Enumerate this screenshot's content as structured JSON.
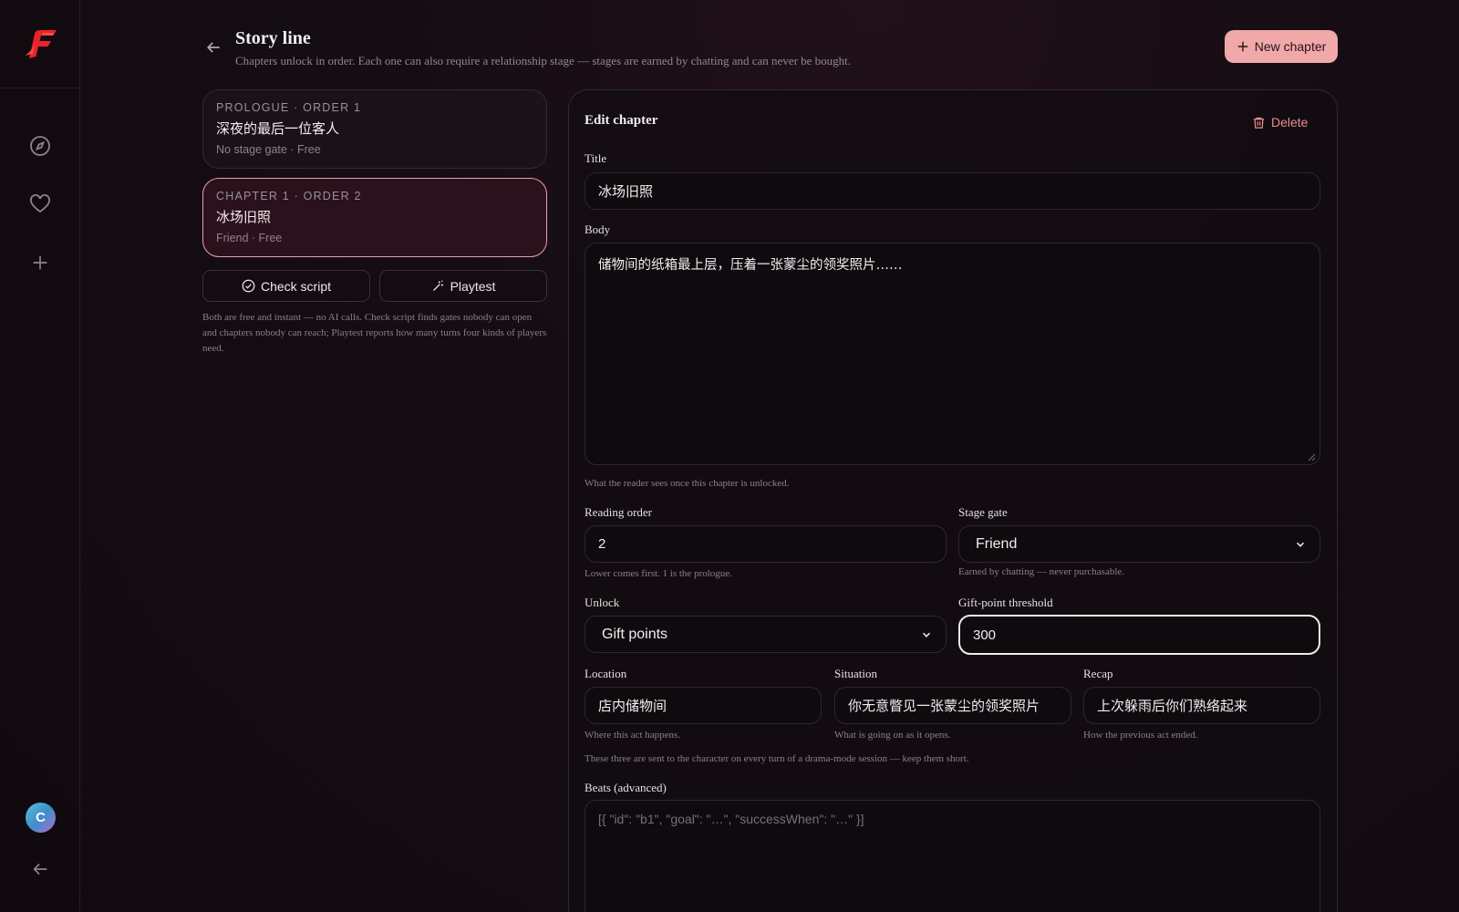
{
  "sidebar": {
    "logo": "flame-f-logo",
    "items": [
      {
        "icon": "compass-icon",
        "label": "Discover"
      },
      {
        "icon": "heart-icon",
        "label": "Favorites"
      },
      {
        "icon": "plus-icon",
        "label": "Create"
      }
    ],
    "avatar_letter": "C"
  },
  "header": {
    "title": "Story line",
    "subtitle": "Chapters unlock in order. Each one can also require a relationship stage — stages are earned by chatting and can never be bought.",
    "new_chapter_label": "New chapter"
  },
  "chapters": [
    {
      "kicker": "PROLOGUE · ORDER 1",
      "title": "深夜的最后一位客人",
      "meta": "No stage gate · Free",
      "active": false
    },
    {
      "kicker": "CHAPTER 1 · ORDER 2",
      "title": "冰场旧照",
      "meta": "Friend · Free",
      "active": true
    }
  ],
  "tools": {
    "check_script_label": "Check script",
    "playtest_label": "Playtest",
    "note": "Both are free and instant — no AI calls. Check script finds gates nobody can open and chapters nobody can reach; Playtest reports how many turns four kinds of players need."
  },
  "editor": {
    "heading": "Edit chapter",
    "delete_label": "Delete",
    "title_label": "Title",
    "title_value": "冰场旧照",
    "body_label": "Body",
    "body_value": "储物间的纸箱最上层，压着一张蒙尘的领奖照片……",
    "body_hint": "What the reader sees once this chapter is unlocked.",
    "order_label": "Reading order",
    "order_value": "2",
    "order_hint": "Lower comes first. 1 is the prologue.",
    "stage_label": "Stage gate",
    "stage_value": "Friend",
    "stage_hint": "Earned by chatting — never purchasable.",
    "unlock_label": "Unlock",
    "unlock_value": "Gift points",
    "threshold_label": "Gift-point threshold",
    "threshold_value": "300",
    "location_label": "Location",
    "location_value": "店内储物间",
    "location_hint": "Where this act happens.",
    "situation_label": "Situation",
    "situation_value": "你无意瞥见一张蒙尘的领奖照片",
    "situation_hint": "What is going on as it opens.",
    "recap_label": "Recap",
    "recap_value": "上次躲雨后你们熟络起来",
    "recap_hint": "How the previous act ended.",
    "trio_note": "These three are sent to the character on every turn of a drama-mode session — keep them short.",
    "beats_label": "Beats (advanced)",
    "beats_placeholder": "[{ \"id\": \"b1\", \"goal\": \"…\", \"successWhen\": \"…\" }]"
  },
  "colors": {
    "accent": "#f0a8a8",
    "logo_red": "#e8232f",
    "danger": "#e88e8e"
  }
}
